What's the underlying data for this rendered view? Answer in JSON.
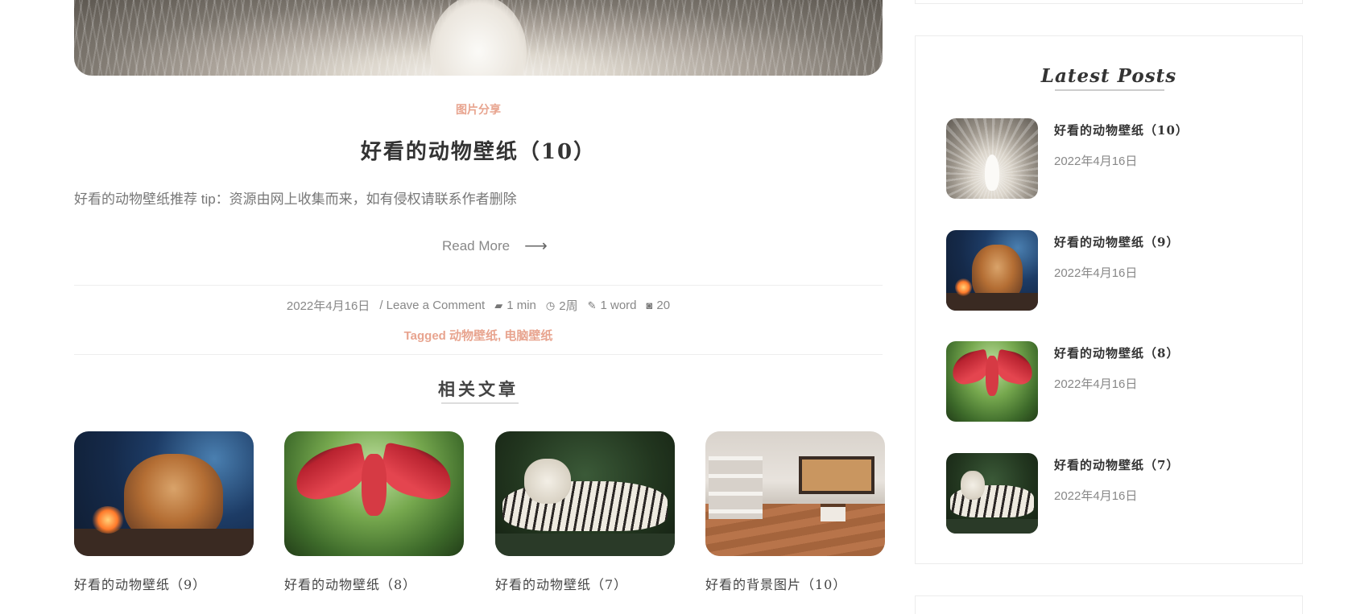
{
  "post": {
    "category": "图片分享",
    "title": "好看的动物壁纸（10）",
    "excerpt": "好看的动物壁纸推荐 tip：资源由网上收集而来，如有侵权请联系作者删除",
    "read_more": "Read More",
    "meta": {
      "date": "2022年4月16日",
      "comment": "/ Leave a Comment",
      "read_time": "1 min",
      "age": "2周",
      "words": "1 word",
      "photos": "20"
    },
    "tags_label": "Tagged",
    "tags": "动物壁纸, 电脑壁纸"
  },
  "related": {
    "title": "相关文章",
    "items": [
      {
        "title": "好看的动物壁纸（9）"
      },
      {
        "title": "好看的动物壁纸（8）"
      },
      {
        "title": "好看的动物壁纸（7）"
      },
      {
        "title": "好看的背景图片（10）"
      }
    ]
  },
  "sidebar": {
    "latest_posts": {
      "title": "Latest Posts",
      "items": [
        {
          "title": "好看的动物壁纸（10）",
          "date": "2022年4月16日"
        },
        {
          "title": "好看的动物壁纸（9）",
          "date": "2022年4月16日"
        },
        {
          "title": "好看的动物壁纸（8）",
          "date": "2022年4月16日"
        },
        {
          "title": "好看的动物壁纸（7）",
          "date": "2022年4月16日"
        }
      ]
    }
  },
  "icons": {
    "read_more": "arrow-right-icon",
    "read_time": "book-icon",
    "age": "clock-icon",
    "words": "edit-icon",
    "photos": "camera-icon"
  },
  "colors": {
    "accent": "#e8a48f",
    "text": "#444444",
    "muted": "#888888",
    "border": "#ececec"
  }
}
